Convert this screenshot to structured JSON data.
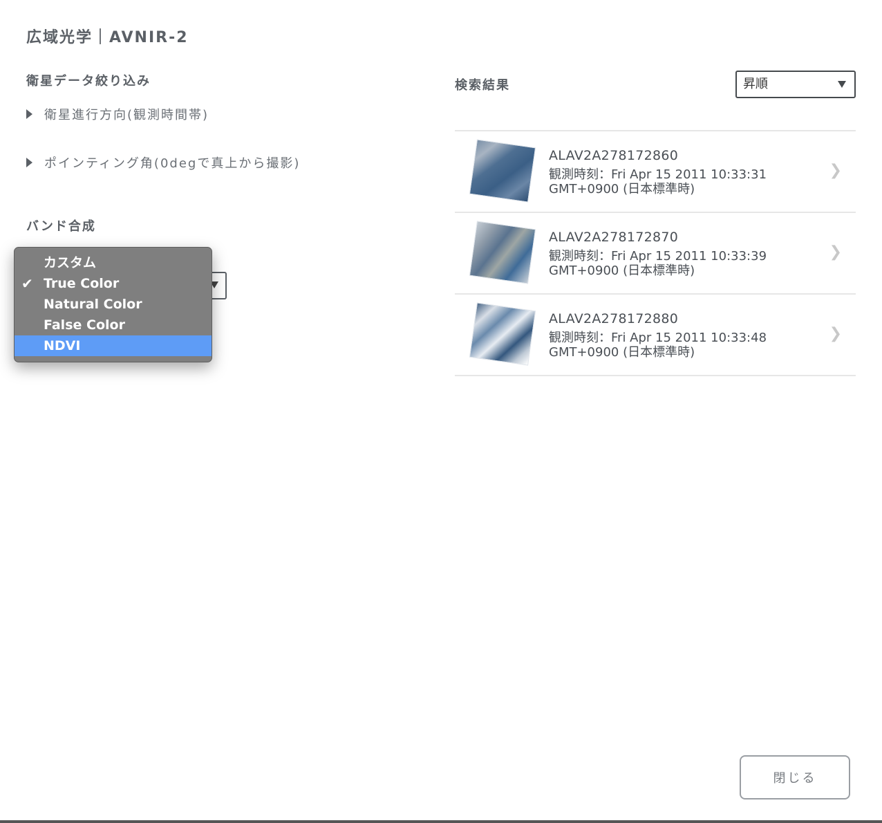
{
  "title": "広域光学｜AVNIR-2",
  "filters": {
    "heading": "衛星データ絞り込み",
    "direction_label": "衛星進行方向(観測時間帯)",
    "pointing_label": "ポインティング角(0degで真上から撮影)"
  },
  "band": {
    "heading": "バンド合成",
    "selected": "True Color",
    "options": [
      "カスタム",
      "True Color",
      "Natural Color",
      "False Color",
      "NDVI"
    ],
    "highlighted": "NDVI"
  },
  "results": {
    "heading": "検索結果",
    "sort_value": "昇順",
    "items": [
      {
        "id": "ALAV2A278172860",
        "time": "観測時刻：Fri Apr 15 2011 10:33:31 GMT+0900 (日本標準時)"
      },
      {
        "id": "ALAV2A278172870",
        "time": "観測時刻：Fri Apr 15 2011 10:33:39 GMT+0900 (日本標準時)"
      },
      {
        "id": "ALAV2A278172880",
        "time": "観測時刻：Fri Apr 15 2011 10:33:48 GMT+0900 (日本標準時)"
      }
    ]
  },
  "close_label": "閉じる",
  "icons": {
    "check": "checkmark-icon",
    "disclosure": "triangle-right-icon",
    "chevron": "chevron-right-icon"
  },
  "colors": {
    "highlight": "#5e9cf6",
    "popup_bg": "#7f7f7f"
  }
}
